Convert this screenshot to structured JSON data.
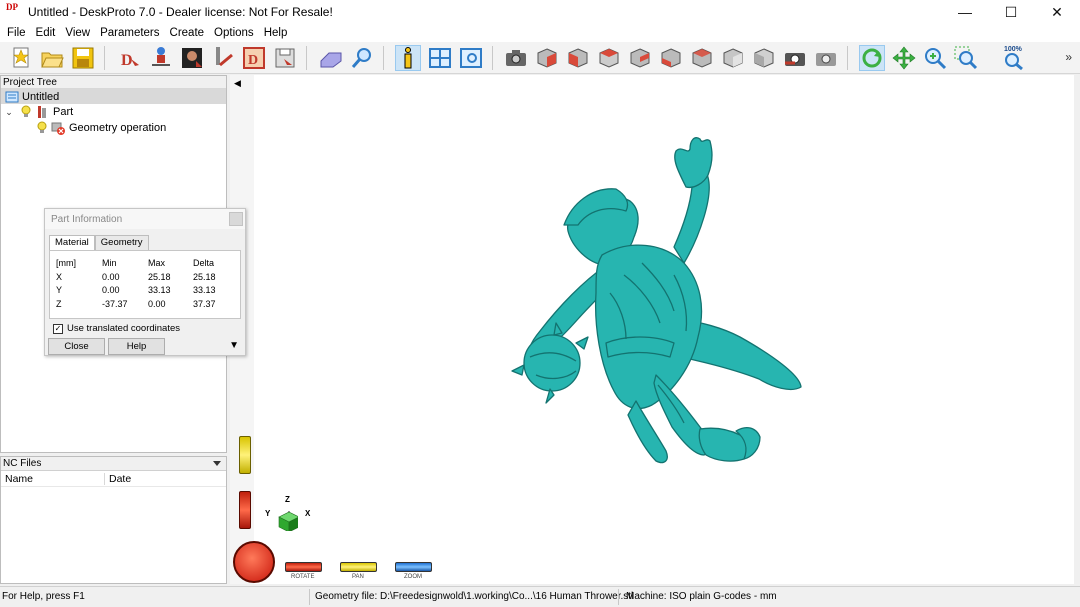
{
  "window": {
    "title": "Untitled - DeskProto 7.0 - Dealer license: Not For Resale!",
    "logo_text": "DP",
    "controls": {
      "minimize": "—",
      "maximize": "☐",
      "close": "✕"
    }
  },
  "menu": [
    "File",
    "Edit",
    "View",
    "Parameters",
    "Create",
    "Options",
    "Help"
  ],
  "toolbar": {
    "zoom_label": "100%",
    "overflow": "»"
  },
  "project_tree": {
    "header": "Project Tree",
    "root": "Untitled",
    "part": "Part",
    "operation": "Geometry operation"
  },
  "nc_files": {
    "header": "NC Files",
    "columns": [
      "Name",
      "Date"
    ]
  },
  "part_info": {
    "title": "Part Information",
    "tabs": [
      "Material",
      "Geometry"
    ],
    "columns": [
      "[mm]",
      "Min",
      "Max",
      "Delta"
    ],
    "rows": [
      [
        "X",
        "0.00",
        "25.18",
        "25.18"
      ],
      [
        "Y",
        "0.00",
        "33.13",
        "33.13"
      ],
      [
        "Z",
        "-37.37",
        "0.00",
        "37.37"
      ]
    ],
    "checkbox_label": "Use translated coordinates",
    "checkbox_checked": true,
    "close_label": "Close",
    "help_label": "Help"
  },
  "viewport": {
    "model_color": "#27b5b0",
    "axes": {
      "x": "X",
      "y": "Y",
      "z": "Z"
    },
    "controls": [
      "ROTATE",
      "PAN",
      "ZOOM"
    ]
  },
  "status": {
    "help": "For Help, press F1",
    "geometry_file": "Geometry file: D:\\Freedesignwold\\1.working\\Co...\\16 Human Thrower.stl",
    "machine": "Machine: ISO plain G-codes - mm"
  }
}
